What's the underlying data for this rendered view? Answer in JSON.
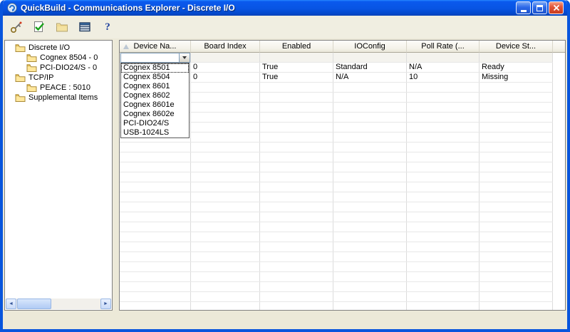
{
  "window": {
    "title": "QuickBuild - Communications Explorer - Discrete I/O"
  },
  "toolbar": {
    "icons": [
      "key-icon",
      "validate-check-icon",
      "folder-icon",
      "device-list-icon",
      "help-icon"
    ]
  },
  "tree": {
    "items": [
      {
        "label": "Discrete I/O",
        "level": 0
      },
      {
        "label": "Cognex 8504 - 0",
        "level": 1
      },
      {
        "label": "PCI-DIO24/S - 0",
        "level": 1
      },
      {
        "label": "TCP/IP",
        "level": 0
      },
      {
        "label": "PEACE : 5010",
        "level": 1
      },
      {
        "label": "Supplemental Items",
        "level": 0
      }
    ]
  },
  "grid": {
    "columns": [
      {
        "label": "Device Na...",
        "sorted": true
      },
      {
        "label": "Board Index"
      },
      {
        "label": "Enabled"
      },
      {
        "label": "IOConfig"
      },
      {
        "label": "Poll Rate (..."
      },
      {
        "label": "Device St..."
      }
    ],
    "rows": [
      [
        "",
        "0",
        "True",
        "Standard",
        "N/A",
        "Ready"
      ],
      [
        "",
        "0",
        "True",
        "N/A",
        "10",
        "Missing"
      ]
    ]
  },
  "combobox": {
    "value": ""
  },
  "dropdown": {
    "options": [
      "Cognex 8501",
      "Cognex 8504",
      "Cognex 8601",
      "Cognex 8602",
      "Cognex 8601e",
      "Cognex 8602e",
      "PCI-DIO24/S",
      "USB-1024LS"
    ],
    "focused_index": 0
  },
  "colors": {
    "title_bar": "#0854E3",
    "window_border": "#0855DD",
    "toolbar_bg": "#F0EEE1",
    "close_button": "#D6492A",
    "check_green": "#18A018",
    "folder_yellow": "#F6DF8C"
  }
}
